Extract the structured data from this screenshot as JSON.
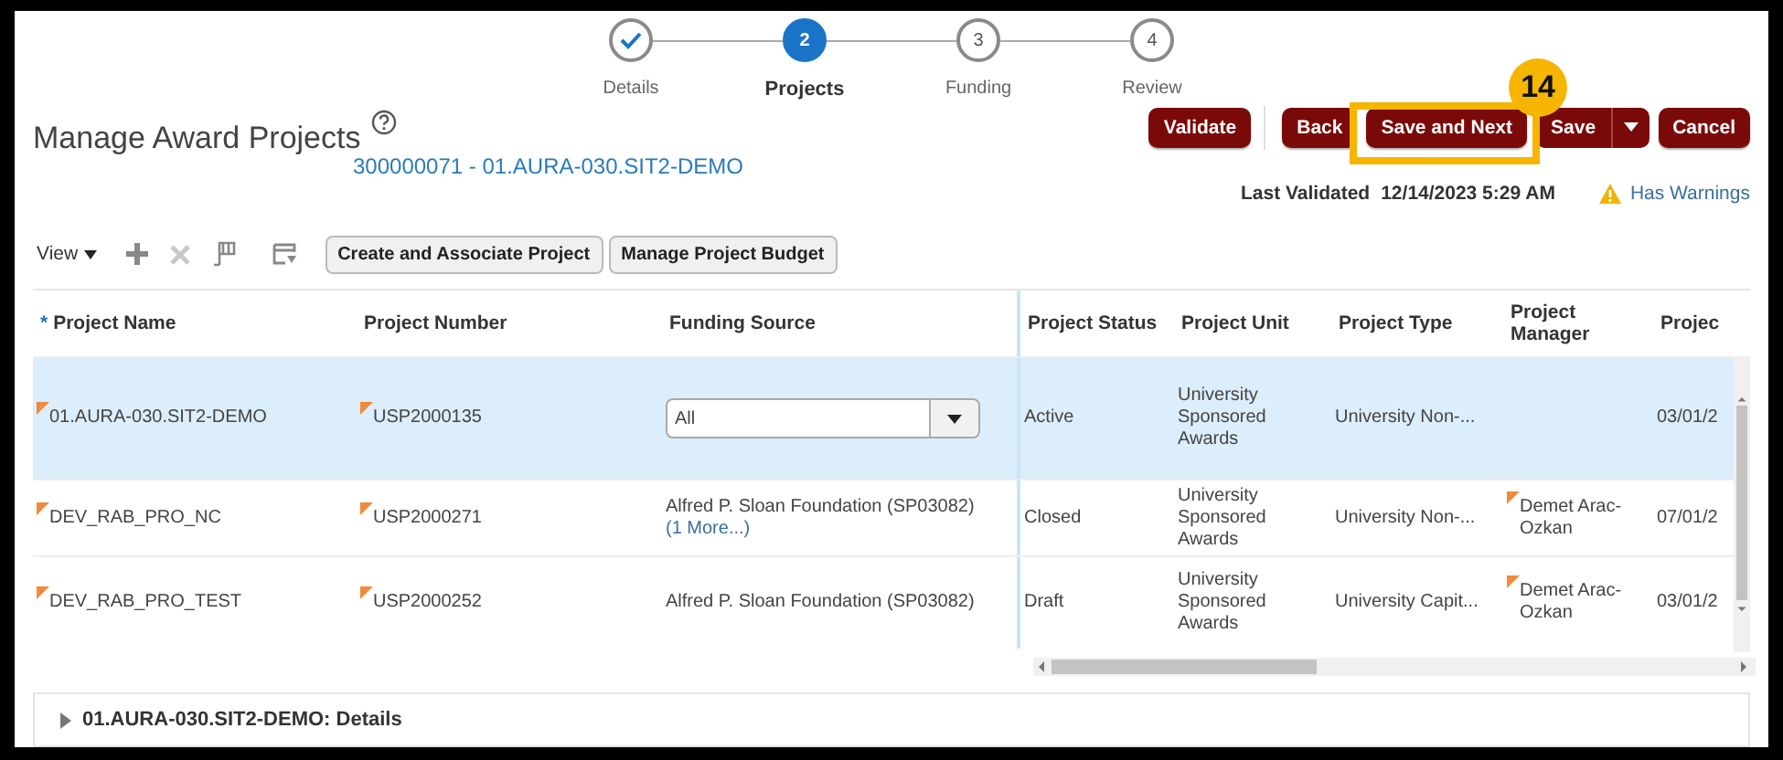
{
  "stepper": [
    {
      "label": "Details",
      "done": true,
      "selected": false
    },
    {
      "number": "2",
      "label": "Projects",
      "done": false,
      "selected": true
    },
    {
      "number": "3",
      "label": "Funding",
      "done": false,
      "selected": false
    },
    {
      "number": "4",
      "label": "Review",
      "done": false,
      "selected": false
    }
  ],
  "page": {
    "title": "Manage Award Projects",
    "award_link": "300000071 - 01.AURA-030.SIT2-DEMO"
  },
  "action_groups": [
    [
      {
        "label": "Validate",
        "kind": "button"
      }
    ],
    [
      {
        "label": "Back",
        "kind": "button"
      },
      {
        "label": "Save and Next",
        "kind": "button",
        "callout": "14"
      },
      {
        "label": "Save",
        "kind": "split"
      },
      {
        "label": "Cancel",
        "kind": "button"
      }
    ]
  ],
  "validation": {
    "label": "Last Validated",
    "timestamp": "12/14/2023 5:29 AM",
    "warning_link": "Has Warnings"
  },
  "toolbar": {
    "view_menu": "View",
    "icons": [
      {
        "kind": "add",
        "disabled": false
      },
      {
        "kind": "delete",
        "disabled": true
      },
      {
        "kind": "freeze",
        "disabled": false
      },
      {
        "kind": "detach",
        "disabled": false
      }
    ],
    "buttons": [
      "Create and Associate Project",
      "Manage Project Budget"
    ]
  },
  "table": {
    "columns": [
      {
        "label": "Project Name",
        "marker": "*"
      },
      {
        "label": "Project Number"
      },
      {
        "label": "Funding Source"
      },
      {
        "label": "Project Status"
      },
      {
        "label": "Project Unit"
      },
      {
        "label": "Project Type"
      },
      {
        "label": "Project Manager"
      },
      {
        "label": "Projec"
      }
    ],
    "rows": [
      {
        "selected": true,
        "cells": [
          {
            "kind": "text",
            "text": "01.AURA-030.SIT2-DEMO",
            "flagged": true
          },
          {
            "kind": "text",
            "text": "USP2000135",
            "flagged": true
          },
          {
            "kind": "select",
            "text": "All"
          },
          {
            "kind": "text",
            "text": "Active"
          },
          {
            "kind": "text",
            "text": "University Sponsored Awards"
          },
          {
            "kind": "text",
            "text": "University Non-..."
          },
          {
            "kind": "empty"
          },
          {
            "kind": "text",
            "text": "03/01/2"
          }
        ]
      },
      {
        "selected": false,
        "cells": [
          {
            "kind": "text",
            "text": "DEV_RAB_PRO_NC",
            "flagged": true
          },
          {
            "kind": "text",
            "text": "USP2000271",
            "flagged": true
          },
          {
            "kind": "text_link",
            "text": "Alfred P. Sloan Foundation (SP03082)",
            "link": "(1 More...)"
          },
          {
            "kind": "text",
            "text": "Closed"
          },
          {
            "kind": "text",
            "text": "University Sponsored Awards"
          },
          {
            "kind": "text",
            "text": "University Non-..."
          },
          {
            "kind": "text",
            "text": "Demet Arac-Ozkan",
            "flagged": true
          },
          {
            "kind": "text",
            "text": "07/01/2"
          }
        ]
      },
      {
        "selected": false,
        "cells": [
          {
            "kind": "text",
            "text": "DEV_RAB_PRO_TEST",
            "flagged": true
          },
          {
            "kind": "text",
            "text": "USP2000252",
            "flagged": true
          },
          {
            "kind": "text",
            "text": "Alfred P. Sloan Foundation (SP03082)"
          },
          {
            "kind": "text",
            "text": "Draft"
          },
          {
            "kind": "text",
            "text": "University Sponsored Awards"
          },
          {
            "kind": "text",
            "text": "University Capit..."
          },
          {
            "kind": "text",
            "text": "Demet Arac-Ozkan",
            "flagged": true
          },
          {
            "kind": "text",
            "text": "03/01/2"
          }
        ]
      }
    ]
  },
  "details_section": {
    "title": "01.AURA-030.SIT2-DEMO: Details",
    "expanded": false
  }
}
